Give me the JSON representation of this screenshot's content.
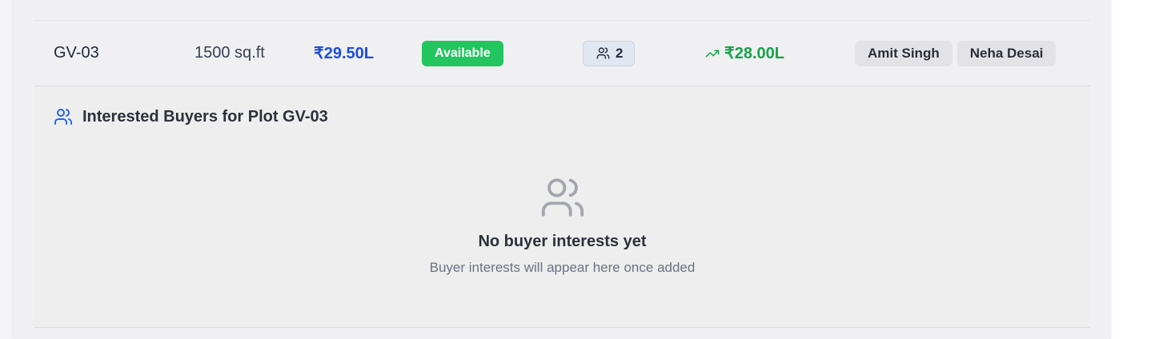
{
  "plot_row": {
    "plot_id": "GV-03",
    "area": "1500 sq.ft",
    "price": "₹29.50L",
    "status": "Available",
    "interest_count": "2",
    "best_offer": "₹28.00L",
    "agents": [
      "Amit Singh",
      "Neha Desai"
    ]
  },
  "buyers_panel": {
    "title": "Interested Buyers for Plot GV-03",
    "empty_title": "No buyer interests yet",
    "empty_subtitle": "Buyer interests will appear here once added"
  },
  "icons": {
    "panel_header": "users-icon",
    "interest_pill": "users-icon",
    "offer": "trending-up-icon",
    "empty_state": "users-icon"
  },
  "colors": {
    "price": "#1d4ed8",
    "status_available": "#22c55e",
    "offer": "#16a34a",
    "panel_icon": "#2563eb",
    "empty_icon": "#a3a6ad"
  }
}
